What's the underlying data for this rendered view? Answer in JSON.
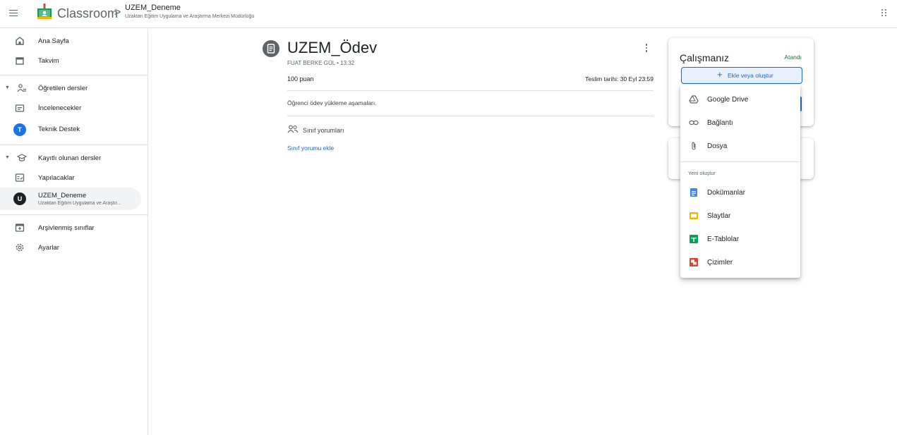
{
  "header": {
    "brand": "Classroom",
    "breadcrumb_separator": ">",
    "class_name": "UZEM_Deneme",
    "class_subtitle": "Uzaktan Eğitim Uygulama ve Araştırma Merkezi Müdürlüğü"
  },
  "sidebar": {
    "home": "Ana Sayfa",
    "calendar": "Takvim",
    "teaching": "Öğretilen dersler",
    "to_review": "İncelenecekler",
    "teaching_class": {
      "avatar": "T",
      "label": "Teknik Destek",
      "color": "#1a73e8"
    },
    "enrolled": "Kayıtlı olunan dersler",
    "todo": "Yapılacaklar",
    "enrolled_class": {
      "avatar": "U",
      "label": "UZEM_Deneme",
      "sublabel": "Uzaktan Eğitim Uygulama ve Araştır...",
      "color": "#202124"
    },
    "archived": "Arşivlenmiş sınıflar",
    "settings": "Ayarlar"
  },
  "assignment": {
    "title": "UZEM_Ödev",
    "meta": "FUAT BERKE GÜL • 13:32",
    "points": "100 puan",
    "due": "Teslim tarihi: 30 Eyl 23:59",
    "description": "Öğrenci ödev yükleme aşamaları.",
    "comments_label": "Sınıf yorumları",
    "add_comment": "Sınıf yorumu ekle"
  },
  "work_card": {
    "title": "Çalışmanız",
    "status": "Atandı",
    "add_button": "Ekle veya oluştur"
  },
  "menu": {
    "items": [
      "Google Drive",
      "Bağlantı",
      "Dosya"
    ],
    "create_header": "Yeni oluştur",
    "create_items": [
      "Dokümanlar",
      "Slaytlar",
      "E-Tablolar",
      "Çizimler"
    ]
  },
  "colors": {
    "accent": "#1967d2",
    "status_green": "#137333",
    "docs": "#4285f4",
    "slides": "#f4b400",
    "sheets": "#0f9d58",
    "drawings": "#db4437"
  }
}
